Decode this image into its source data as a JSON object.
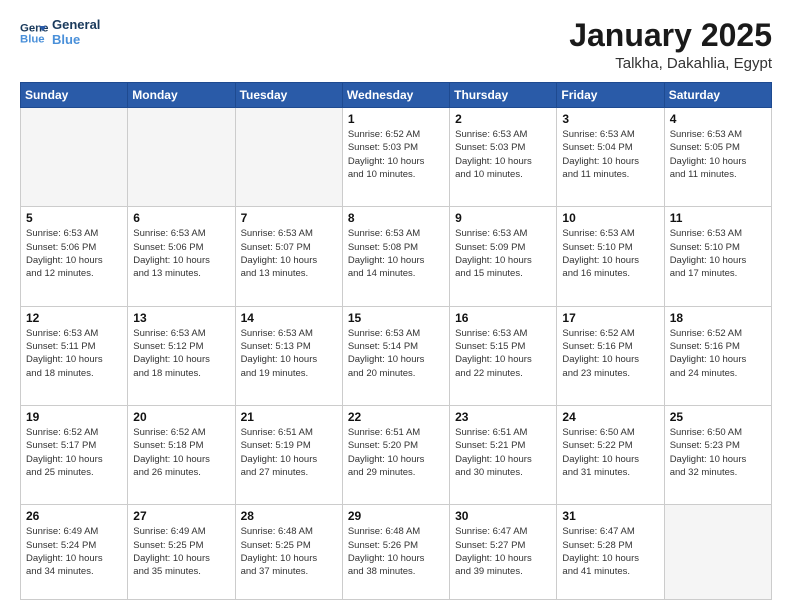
{
  "logo": {
    "line1": "General",
    "line2": "Blue"
  },
  "header": {
    "month": "January 2025",
    "location": "Talkha, Dakahlia, Egypt"
  },
  "weekdays": [
    "Sunday",
    "Monday",
    "Tuesday",
    "Wednesday",
    "Thursday",
    "Friday",
    "Saturday"
  ],
  "weeks": [
    [
      {
        "day": "",
        "info": ""
      },
      {
        "day": "",
        "info": ""
      },
      {
        "day": "",
        "info": ""
      },
      {
        "day": "1",
        "info": "Sunrise: 6:52 AM\nSunset: 5:03 PM\nDaylight: 10 hours\nand 10 minutes."
      },
      {
        "day": "2",
        "info": "Sunrise: 6:53 AM\nSunset: 5:03 PM\nDaylight: 10 hours\nand 10 minutes."
      },
      {
        "day": "3",
        "info": "Sunrise: 6:53 AM\nSunset: 5:04 PM\nDaylight: 10 hours\nand 11 minutes."
      },
      {
        "day": "4",
        "info": "Sunrise: 6:53 AM\nSunset: 5:05 PM\nDaylight: 10 hours\nand 11 minutes."
      }
    ],
    [
      {
        "day": "5",
        "info": "Sunrise: 6:53 AM\nSunset: 5:06 PM\nDaylight: 10 hours\nand 12 minutes."
      },
      {
        "day": "6",
        "info": "Sunrise: 6:53 AM\nSunset: 5:06 PM\nDaylight: 10 hours\nand 13 minutes."
      },
      {
        "day": "7",
        "info": "Sunrise: 6:53 AM\nSunset: 5:07 PM\nDaylight: 10 hours\nand 13 minutes."
      },
      {
        "day": "8",
        "info": "Sunrise: 6:53 AM\nSunset: 5:08 PM\nDaylight: 10 hours\nand 14 minutes."
      },
      {
        "day": "9",
        "info": "Sunrise: 6:53 AM\nSunset: 5:09 PM\nDaylight: 10 hours\nand 15 minutes."
      },
      {
        "day": "10",
        "info": "Sunrise: 6:53 AM\nSunset: 5:10 PM\nDaylight: 10 hours\nand 16 minutes."
      },
      {
        "day": "11",
        "info": "Sunrise: 6:53 AM\nSunset: 5:10 PM\nDaylight: 10 hours\nand 17 minutes."
      }
    ],
    [
      {
        "day": "12",
        "info": "Sunrise: 6:53 AM\nSunset: 5:11 PM\nDaylight: 10 hours\nand 18 minutes."
      },
      {
        "day": "13",
        "info": "Sunrise: 6:53 AM\nSunset: 5:12 PM\nDaylight: 10 hours\nand 18 minutes."
      },
      {
        "day": "14",
        "info": "Sunrise: 6:53 AM\nSunset: 5:13 PM\nDaylight: 10 hours\nand 19 minutes."
      },
      {
        "day": "15",
        "info": "Sunrise: 6:53 AM\nSunset: 5:14 PM\nDaylight: 10 hours\nand 20 minutes."
      },
      {
        "day": "16",
        "info": "Sunrise: 6:53 AM\nSunset: 5:15 PM\nDaylight: 10 hours\nand 22 minutes."
      },
      {
        "day": "17",
        "info": "Sunrise: 6:52 AM\nSunset: 5:16 PM\nDaylight: 10 hours\nand 23 minutes."
      },
      {
        "day": "18",
        "info": "Sunrise: 6:52 AM\nSunset: 5:16 PM\nDaylight: 10 hours\nand 24 minutes."
      }
    ],
    [
      {
        "day": "19",
        "info": "Sunrise: 6:52 AM\nSunset: 5:17 PM\nDaylight: 10 hours\nand 25 minutes."
      },
      {
        "day": "20",
        "info": "Sunrise: 6:52 AM\nSunset: 5:18 PM\nDaylight: 10 hours\nand 26 minutes."
      },
      {
        "day": "21",
        "info": "Sunrise: 6:51 AM\nSunset: 5:19 PM\nDaylight: 10 hours\nand 27 minutes."
      },
      {
        "day": "22",
        "info": "Sunrise: 6:51 AM\nSunset: 5:20 PM\nDaylight: 10 hours\nand 29 minutes."
      },
      {
        "day": "23",
        "info": "Sunrise: 6:51 AM\nSunset: 5:21 PM\nDaylight: 10 hours\nand 30 minutes."
      },
      {
        "day": "24",
        "info": "Sunrise: 6:50 AM\nSunset: 5:22 PM\nDaylight: 10 hours\nand 31 minutes."
      },
      {
        "day": "25",
        "info": "Sunrise: 6:50 AM\nSunset: 5:23 PM\nDaylight: 10 hours\nand 32 minutes."
      }
    ],
    [
      {
        "day": "26",
        "info": "Sunrise: 6:49 AM\nSunset: 5:24 PM\nDaylight: 10 hours\nand 34 minutes."
      },
      {
        "day": "27",
        "info": "Sunrise: 6:49 AM\nSunset: 5:25 PM\nDaylight: 10 hours\nand 35 minutes."
      },
      {
        "day": "28",
        "info": "Sunrise: 6:48 AM\nSunset: 5:25 PM\nDaylight: 10 hours\nand 37 minutes."
      },
      {
        "day": "29",
        "info": "Sunrise: 6:48 AM\nSunset: 5:26 PM\nDaylight: 10 hours\nand 38 minutes."
      },
      {
        "day": "30",
        "info": "Sunrise: 6:47 AM\nSunset: 5:27 PM\nDaylight: 10 hours\nand 39 minutes."
      },
      {
        "day": "31",
        "info": "Sunrise: 6:47 AM\nSunset: 5:28 PM\nDaylight: 10 hours\nand 41 minutes."
      },
      {
        "day": "",
        "info": ""
      }
    ]
  ]
}
